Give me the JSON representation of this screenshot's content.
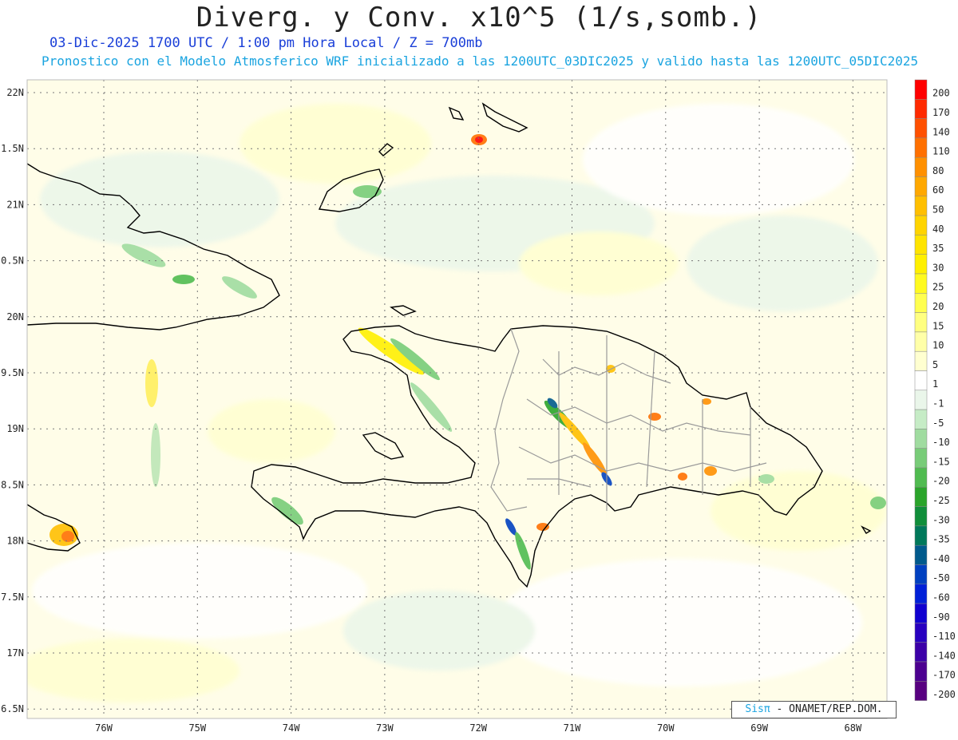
{
  "header": {
    "title": "Diverg. y Conv. x10^5 (1/s,somb.)",
    "line1": "03-Dic-2025  1700 UTC / 1:00 pm Hora Local / Z = 700mb",
    "line2": "Pronostico con el Modelo Atmosferico WRF inicializado a las 1200UTC_03DIC2025 y valido hasta las  1200UTC_05DIC2025"
  },
  "axes": {
    "lat_labels": [
      "22N",
      "1.5N",
      "21N",
      "0.5N",
      "20N",
      "9.5N",
      "19N",
      "8.5N",
      "18N",
      "7.5N",
      "17N",
      "6.5N"
    ],
    "lon_labels": [
      "76W",
      "75W",
      "74W",
      "73W",
      "72W",
      "71W",
      "70W",
      "69W",
      "68W"
    ]
  },
  "colorbar": {
    "labels": [
      "200",
      "170",
      "140",
      "110",
      "80",
      "60",
      "50",
      "40",
      "35",
      "30",
      "25",
      "20",
      "15",
      "10",
      "5",
      "1",
      "-1",
      "-5",
      "-10",
      "-15",
      "-20",
      "-25",
      "-30",
      "-35",
      "-40",
      "-50",
      "-60",
      "-90",
      "-110",
      "-140",
      "-170",
      "-200"
    ],
    "colors": [
      "#ff0000",
      "#ff2a00",
      "#ff5000",
      "#ff7000",
      "#ff9000",
      "#ffa800",
      "#ffbf00",
      "#ffd400",
      "#ffe400",
      "#fff000",
      "#fffa20",
      "#ffff50",
      "#ffff80",
      "#ffffa8",
      "#ffffd0",
      "#ffffff",
      "#eaf6ea",
      "#c6ecc6",
      "#a0dca0",
      "#78cc78",
      "#50bb50",
      "#2aa42a",
      "#108e3a",
      "#00785a",
      "#005a8c",
      "#0040c0",
      "#0020d8",
      "#1000d0",
      "#2800c0",
      "#3c00a8",
      "#4c0090",
      "#580080"
    ]
  },
  "credit": {
    "sis": "Sisπ",
    "rest": " - ONAMET/REP.DOM."
  }
}
